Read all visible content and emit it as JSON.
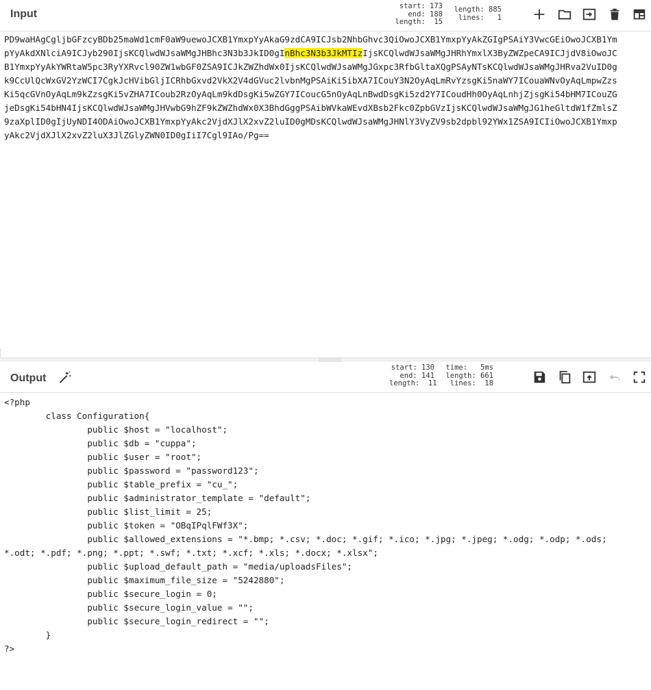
{
  "input": {
    "title": "Input",
    "stats": {
      "start": "start: 173",
      "end": "end: 188",
      "length": "length:  15",
      "total_length": "length: 885",
      "lines": "lines:   1"
    },
    "lines": [
      {
        "pre": "PD9waHAgCgljbGFzcyBDb25maWd1cmF0aW9uewoJCXB1YmxpYyAkaG9zdCA9ICJsb2NhbGhvc3QiOwoJCXB1YmxpYyAkZGIgPSAiY3VwcGEiOwoJCXB1Ym",
        "hl": "",
        "post": ""
      },
      {
        "pre": "pYyAkdXNlciA9ICJyb290IjsKCQlwdWJsaWMgJHBhc3N3b3JkID0gI",
        "hl": "nBhc3N3b3JkMTIz",
        "post": "IjsKCQlwdWJsaWMgJHRhYmxlX3ByZWZpeCA9ICJjdV8iOwoJC"
      },
      {
        "pre": "B1YmxpYyAkYWRtaW5pc3RyYXRvcl90ZW1wbGF0ZSA9ICJkZWZhdWx0IjsKCQlwdWJsaWMgJGxpc3RfbGltaXQgPSAyNTsKCQlwdWJsaWMgJHRva2VuID0g",
        "hl": "",
        "post": ""
      },
      {
        "pre": "k9CcUlQcWxGV2YzWCI7CgkJcHVibGljICRhbGxvd2VkX2V4dGVuc2lvbnMgPSAiKi5ibXA7ICouY3N2OyAqLmRvYzsgKi5naWY7ICouaWNvOyAqLmpwZzs",
        "hl": "",
        "post": ""
      },
      {
        "pre": "Ki5qcGVnOyAqLm9kZzsgKi5vZHA7ICoub2RzOyAqLm9kdDsgKi5wZGY7ICoucG5nOyAqLnBwdDsgKi5zd2Y7ICoudHh0OyAqLnhjZjsgKi54bHM7ICouZG",
        "hl": "",
        "post": ""
      },
      {
        "pre": "jeDsgKi54bHN4IjsKCQlwdWJsaWMgJHVwbG9hZF9kZWZhdWx0X3BhdGggPSAibWVkaWEvdXBsb2Fkc0ZpbGVzIjsKCQlwdWJsaWMgJG1heGltdW1fZmlsZ",
        "hl": "",
        "post": ""
      },
      {
        "pre": "9zaXplID0gIjUyNDI4ODAiOwoJCXB1YmxpYyAkc2VjdXJlX2xvZ2luID0gMDsKCQlwdWJsaWMgJHNlY3VyZV9sb2dpbl92YWx1ZSA9ICIiOwoJCXB1Ymxp",
        "hl": "",
        "post": ""
      },
      {
        "pre": "yAkc2VjdXJlX2xvZ2luX3JlZGlyZWN0ID0gIiI7Cgl9IAo/Pg==",
        "hl": "",
        "post": ""
      }
    ]
  },
  "output": {
    "title": "Output",
    "stats": {
      "start": "start: 130",
      "end": "end: 141",
      "length": "length:  11",
      "time": "time:   5ms",
      "total_length": "length: 661",
      "lines": "lines:  18"
    },
    "text": "<?php\n\tclass Configuration{\n\t\tpublic $host = \"localhost\";\n\t\tpublic $db = \"cuppa\";\n\t\tpublic $user = \"root\";\n\t\tpublic $password = \"password123\";\n\t\tpublic $table_prefix = \"cu_\";\n\t\tpublic $administrator_template = \"default\";\n\t\tpublic $list_limit = 25;\n\t\tpublic $token = \"OBqIPqlFWf3X\";\n\t\tpublic $allowed_extensions = \"*.bmp; *.csv; *.doc; *.gif; *.ico; *.jpg; *.jpeg; *.odg; *.odp; *.ods;\n*.odt; *.pdf; *.png; *.ppt; *.swf; *.txt; *.xcf; *.xls; *.docx; *.xlsx\";\n\t\tpublic $upload_default_path = \"media/uploadsFiles\";\n\t\tpublic $maximum_file_size = \"5242880\";\n\t\tpublic $secure_login = 0;\n\t\tpublic $secure_login_value = \"\";\n\t\tpublic $secure_login_redirect = \"\";\n\t}\n?>"
  },
  "icons": {
    "input_buttons": [
      "plus-icon",
      "folder-icon",
      "import-icon",
      "trash-icon",
      "layout-icon"
    ],
    "output_buttons": [
      "save-icon",
      "copy-icon",
      "replace-input-icon",
      "undo-icon",
      "fullscreen-icon"
    ],
    "magic": "magic-wand-icon"
  },
  "colors": {
    "highlight": "#fff000",
    "text": "#222222",
    "disabled": "#bdbdbd"
  }
}
